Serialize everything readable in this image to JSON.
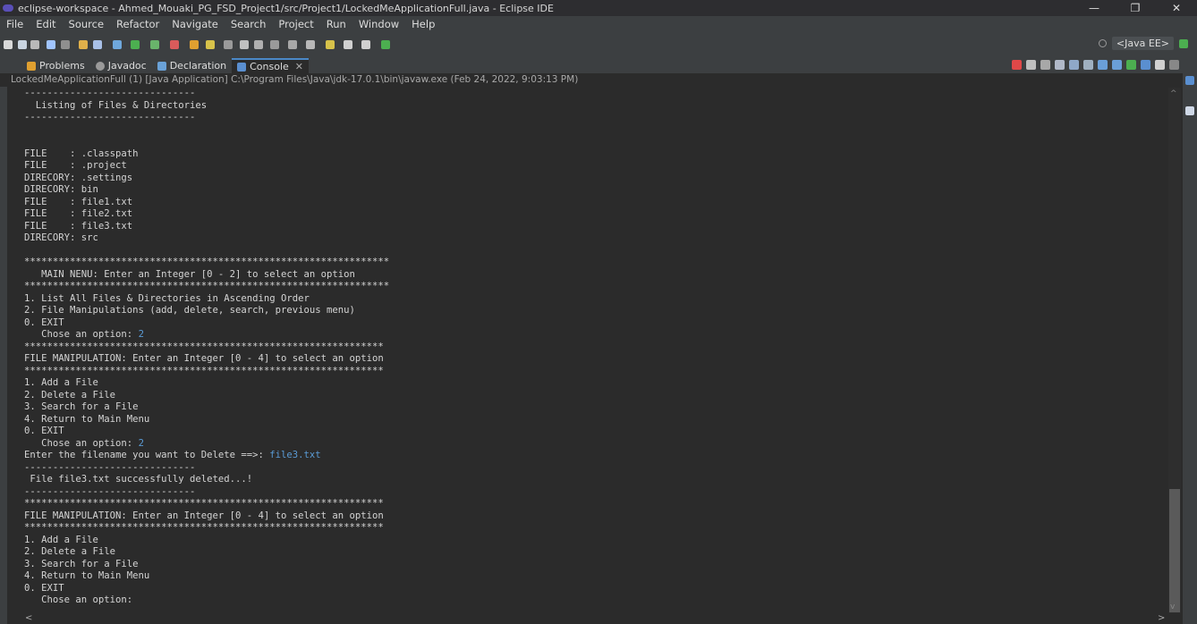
{
  "window": {
    "title": "eclipse-workspace - Ahmed_Mouaki_PG_FSD_Project1/src/Project1/LockedMeApplicationFull.java - Eclipse IDE",
    "minimize": "—",
    "maximize": "❐",
    "close": "✕"
  },
  "menu": [
    "File",
    "Edit",
    "Source",
    "Refactor",
    "Navigate",
    "Search",
    "Project",
    "Run",
    "Window",
    "Help"
  ],
  "perspective": {
    "label": "<Java EE>"
  },
  "tabs": [
    {
      "label": "Problems",
      "icon": "problems-icon",
      "color": "#e0a030"
    },
    {
      "label": "Javadoc",
      "icon": "javadoc-icon",
      "color": "#9a9a9a"
    },
    {
      "label": "Declaration",
      "icon": "declaration-icon",
      "color": "#6aa2d8"
    },
    {
      "label": "Console",
      "icon": "console-icon",
      "color": "#5a8fd0",
      "active": true
    }
  ],
  "launch_info": "LockedMeApplicationFull (1) [Java Application] C:\\Program Files\\Java\\jdk-17.0.1\\bin\\javaw.exe  (Feb 24, 2022, 9:03:13 PM)",
  "console": {
    "lines": [
      {
        "text": "------------------------------"
      },
      {
        "text": "  Listing of Files & Directories"
      },
      {
        "text": "------------------------------"
      },
      {
        "text": ""
      },
      {
        "text": ""
      },
      {
        "text": "FILE    : .classpath"
      },
      {
        "text": "FILE    : .project"
      },
      {
        "text": "DIRECORY: .settings"
      },
      {
        "text": "DIRECORY: bin"
      },
      {
        "text": "FILE    : file1.txt"
      },
      {
        "text": "FILE    : file2.txt"
      },
      {
        "text": "FILE    : file3.txt"
      },
      {
        "text": "DIRECORY: src"
      },
      {
        "text": ""
      },
      {
        "text": "****************************************************************"
      },
      {
        "text": "   MAIN NENU: Enter an Integer [0 - 2] to select an option"
      },
      {
        "text": "****************************************************************"
      },
      {
        "text": "1. List All Files & Directories in Ascending Order"
      },
      {
        "text": "2. File Manipulations (add, delete, search, previous menu)"
      },
      {
        "text": "0. EXIT"
      },
      {
        "text": "   Chose an option: ",
        "input": "2"
      },
      {
        "text": "***************************************************************"
      },
      {
        "text": "FILE MANIPULATION: Enter an Integer [0 - 4] to select an option"
      },
      {
        "text": "***************************************************************"
      },
      {
        "text": "1. Add a File"
      },
      {
        "text": "2. Delete a File"
      },
      {
        "text": "3. Search for a File"
      },
      {
        "text": "4. Return to Main Menu"
      },
      {
        "text": "0. EXIT"
      },
      {
        "text": "   Chose an option: ",
        "input": "2"
      },
      {
        "text": "Enter the filename you want to Delete ==>: ",
        "input": "file3.txt"
      },
      {
        "text": "------------------------------"
      },
      {
        "text": " File file3.txt successfully deleted...!"
      },
      {
        "text": "------------------------------"
      },
      {
        "text": "***************************************************************"
      },
      {
        "text": "FILE MANIPULATION: Enter an Integer [0 - 4] to select an option"
      },
      {
        "text": "***************************************************************"
      },
      {
        "text": "1. Add a File"
      },
      {
        "text": "2. Delete a File"
      },
      {
        "text": "3. Search for a File"
      },
      {
        "text": "4. Return to Main Menu"
      },
      {
        "text": "0. EXIT"
      },
      {
        "text": "   Chose an option: "
      }
    ]
  },
  "colors": {
    "console_bg": "#2b2b2b",
    "chrome_bg": "#3c3f41",
    "console_text": "#d4d4d4",
    "user_input": "#5a9bd5",
    "active_tab_accent": "#4a88c7"
  }
}
